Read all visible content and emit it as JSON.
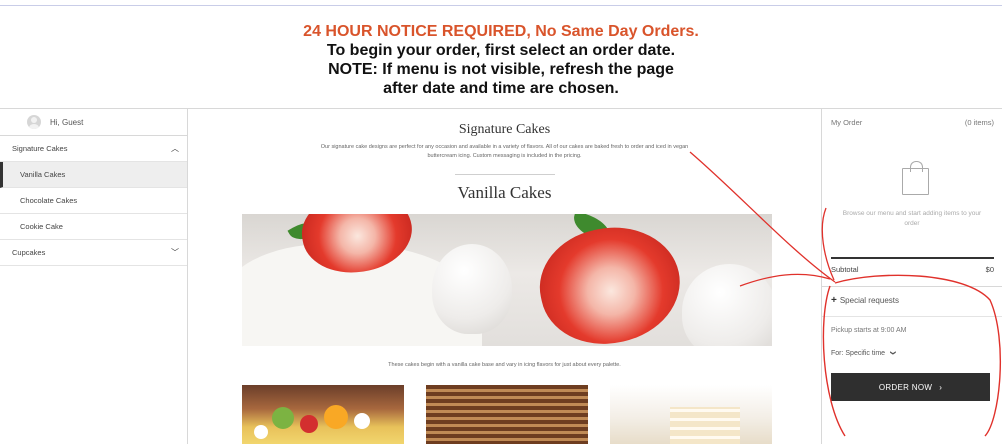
{
  "notice": {
    "line1": "24 HOUR NOTICE REQUIRED, No Same Day Orders.",
    "line2": "To begin your order, first select an order date.",
    "line3": "NOTE: If menu is not visible, refresh the page",
    "line4": "after date and time are chosen."
  },
  "sidebar": {
    "greeting": "Hi, Guest",
    "items": [
      {
        "label": "Signature Cakes",
        "chevron": "up"
      },
      {
        "label": "Vanilla Cakes"
      },
      {
        "label": "Chocolate Cakes"
      },
      {
        "label": "Cookie Cake"
      },
      {
        "label": "Cupcakes",
        "chevron": "down"
      }
    ]
  },
  "main": {
    "category_title": "Signature Cakes",
    "category_desc": "Our signature cake designs are perfect for any occasion and available in a variety of flavors. All of our cakes are baked fresh to order and iced in vegan buttercream icing. Custom messaging is included in the pricing.",
    "section_title": "Vanilla Cakes",
    "section_desc": "These cakes begin with a vanilla cake base and vary in icing flavors for just about every palette."
  },
  "order": {
    "title": "My Order",
    "count": "(0 items)",
    "empty_text": "Browse our menu and start adding items to your order",
    "subtotal_label": "Subtotal",
    "subtotal_value": "$0",
    "special_plus": "+",
    "special_label": "Special requests",
    "pickup_text": "Pickup starts at 9:00 AM",
    "for_label": "For: Specific time",
    "for_chevron": "❯",
    "button_label": "ORDER NOW",
    "button_arrow": "›"
  },
  "colors": {
    "notice_red": "#d9542b",
    "annotation_red": "#e0312b",
    "button_bg": "#2f2f2f"
  },
  "icons": {
    "avatar": "user-avatar-icon",
    "bag": "shopping-bag-icon",
    "chevron_up": "chevron-up-icon",
    "chevron_down": "chevron-down-icon"
  }
}
